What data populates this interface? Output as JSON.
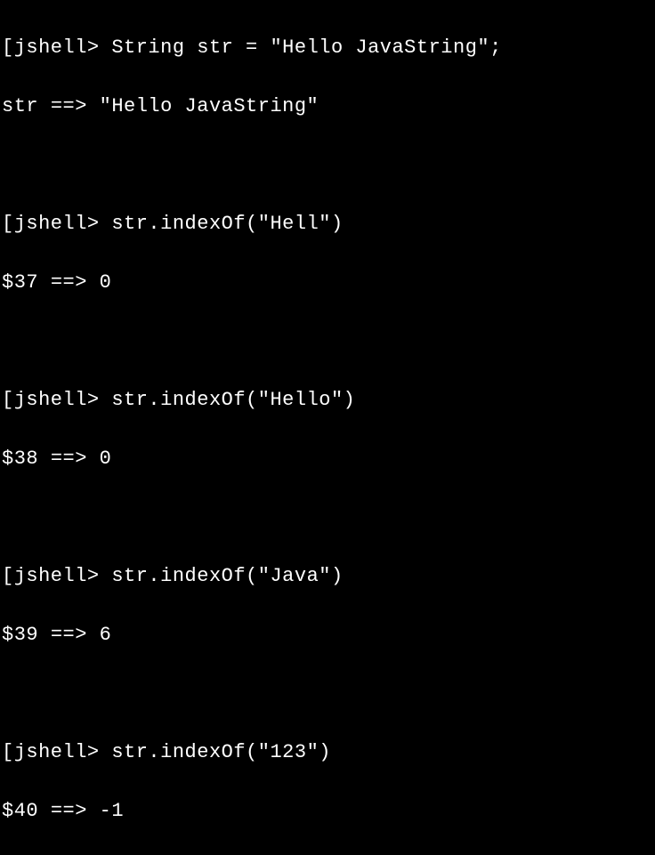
{
  "session": {
    "prompt": "jshell>",
    "arrow": "==>",
    "entries": [
      {
        "input": "String str = \"Hello JavaString\";",
        "result_var": "str",
        "result_value": "\"Hello JavaString\""
      },
      {
        "input": "str.indexOf(\"Hell\")",
        "result_var": "$37",
        "result_value": "0"
      },
      {
        "input": "str.indexOf(\"Hello\")",
        "result_var": "$38",
        "result_value": "0"
      },
      {
        "input": "str.indexOf(\"Java\")",
        "result_var": "$39",
        "result_value": "6"
      },
      {
        "input": "str.indexOf(\"123\")",
        "result_var": "$40",
        "result_value": "-1"
      }
    ]
  }
}
